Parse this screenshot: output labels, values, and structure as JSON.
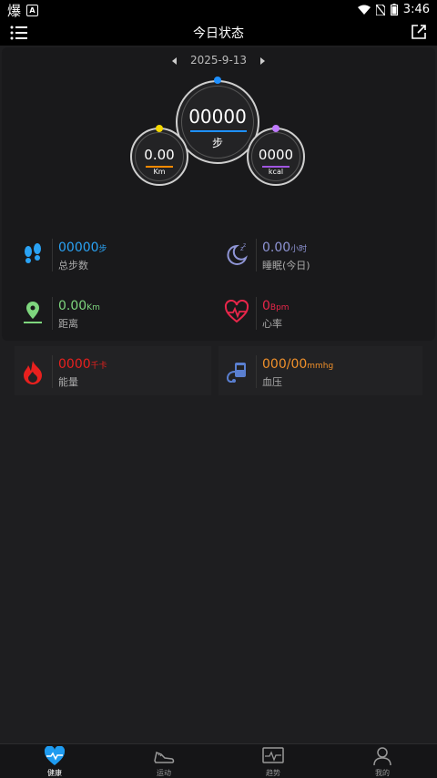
{
  "status_bar": {
    "left_char": "爆",
    "left_badge": "A",
    "time": "3:46"
  },
  "header": {
    "title": "今日状态"
  },
  "date": {
    "value": "2025-9-13"
  },
  "rings": {
    "steps": {
      "value": "00000",
      "unit": "步",
      "dot_color": "#1e90ff",
      "line_color": "#1e90ff"
    },
    "distance": {
      "value": "0.00",
      "unit": "Km",
      "dot_color": "#f5d800",
      "line_color": "#ff8a00"
    },
    "calories": {
      "value": "0000",
      "unit": "kcal",
      "dot_color": "#c07bff",
      "line_color": "#a056e0"
    }
  },
  "stats": [
    {
      "value": "00000",
      "unit": "步",
      "label": "总步数",
      "color": "#2aa3f5",
      "icon": "footprints-icon"
    },
    {
      "value": "0.00",
      "unit": "小时",
      "label": "睡眠(今日)",
      "color": "#8f95d6",
      "icon": "moon-sleep-icon"
    },
    {
      "value": "0.00",
      "unit": "Km",
      "label": "距离",
      "color": "#7ed67e",
      "icon": "location-pin-icon"
    },
    {
      "value": "0",
      "unit": "Bpm",
      "label": "心率",
      "color": "#e8264a",
      "icon": "heart-pulse-icon"
    },
    {
      "value": "0000",
      "unit": "千卡",
      "label": "能量",
      "color": "#e8201e",
      "icon": "flame-icon"
    },
    {
      "value": "000/00",
      "unit": "mmhg",
      "label": "血压",
      "color": "#f0902a",
      "icon": "blood-pressure-icon"
    }
  ],
  "bottom_nav": [
    {
      "label": "健康",
      "icon": "health-heart-icon",
      "active": true
    },
    {
      "label": "运动",
      "icon": "shoe-icon",
      "active": false
    },
    {
      "label": "趋势",
      "icon": "trend-chart-icon",
      "active": false
    },
    {
      "label": "我的",
      "icon": "person-icon",
      "active": false
    }
  ]
}
